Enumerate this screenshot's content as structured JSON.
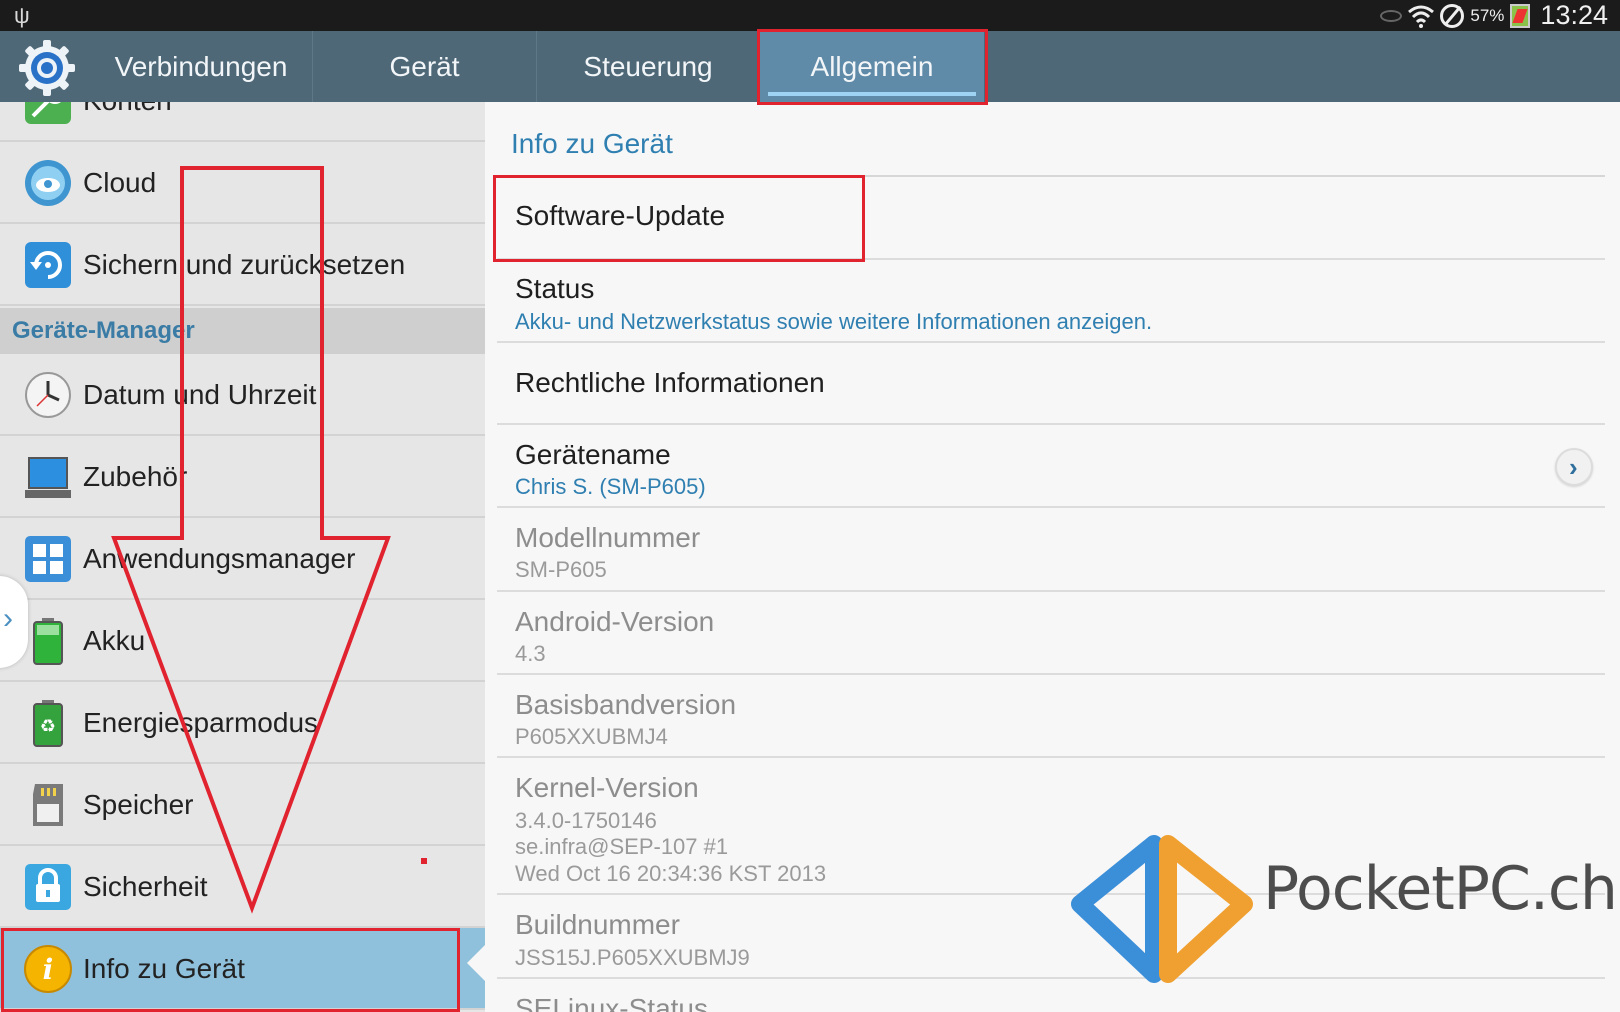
{
  "status_bar": {
    "battery_percent": "57%",
    "time": "13:24"
  },
  "tabs": [
    {
      "label": "Verbindungen"
    },
    {
      "label": "Gerät"
    },
    {
      "label": "Steuerung"
    },
    {
      "label": "Allgemein",
      "active": true
    }
  ],
  "sidebar": {
    "items_top": [
      {
        "label": "Konten",
        "icon": "key-icon"
      },
      {
        "label": "Cloud",
        "icon": "cloud-icon"
      },
      {
        "label": "Sichern und zurücksetzen",
        "icon": "backup-icon"
      }
    ],
    "section_header": "Geräte-Manager",
    "items": [
      {
        "label": "Datum und Uhrzeit",
        "icon": "clock-icon"
      },
      {
        "label": "Zubehör",
        "icon": "accessory-icon"
      },
      {
        "label": "Anwendungsmanager",
        "icon": "apps-grid-icon"
      },
      {
        "label": "Akku",
        "icon": "battery-icon"
      },
      {
        "label": "Energiesparmodus",
        "icon": "recycle-icon"
      },
      {
        "label": "Speicher",
        "icon": "sd-card-icon"
      },
      {
        "label": "Sicherheit",
        "icon": "lock-icon"
      },
      {
        "label": "Info zu Gerät",
        "icon": "info-icon",
        "selected": true
      }
    ]
  },
  "content": {
    "title": "Info zu Gerät",
    "rows": [
      {
        "title": "Software-Update"
      },
      {
        "title": "Status",
        "subtitle": "Akku- und Netzwerkstatus sowie weitere Informationen anzeigen."
      },
      {
        "title": "Rechtliche Informationen"
      },
      {
        "title": "Gerätename",
        "subtitle": "Chris S. (SM-P605)"
      },
      {
        "title": "Modellnummer",
        "subtitle": "SM-P605"
      },
      {
        "title": "Android-Version",
        "subtitle": "4.3"
      },
      {
        "title": "Basisbandversion",
        "subtitle": "P605XXUBMJ4"
      },
      {
        "title": "Kernel-Version",
        "lines": [
          "3.4.0-1750146",
          "se.infra@SEP-107 #1",
          "Wed Oct 16 20:34:36 KST 2013"
        ]
      },
      {
        "title": "Buildnummer",
        "subtitle": "JSS15J.P605XXUBMJ9"
      },
      {
        "title": "SELinux-Status"
      }
    ]
  },
  "watermark": {
    "text": "PocketPC.ch"
  },
  "colors": {
    "accent": "#2f7fb1",
    "tabbar": "#4f6878",
    "highlight": "#e0232f",
    "selected": "#8fc0dc"
  }
}
